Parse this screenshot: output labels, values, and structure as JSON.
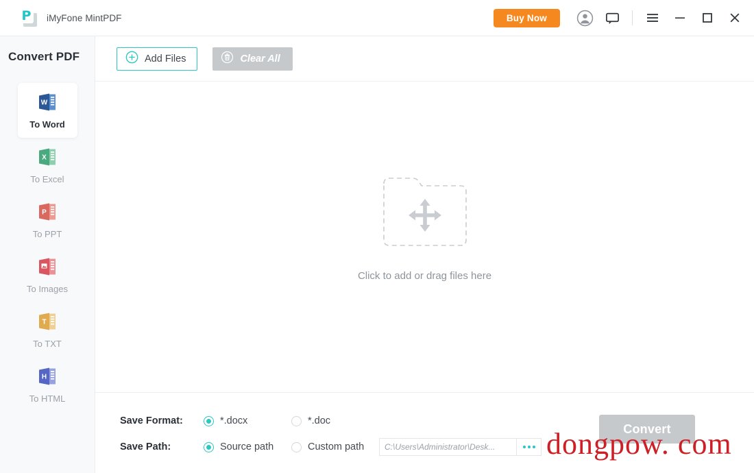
{
  "titlebar": {
    "app_title": "iMyFone MintPDF",
    "logo_letter": "P",
    "buy_now_label": "Buy Now",
    "icons": {
      "account": "account-circle-icon",
      "feedback": "feedback-bubble-icon",
      "menu": "hamburger-menu-icon",
      "minimize": "minimize-icon",
      "maximize": "maximize-icon",
      "close": "close-icon"
    }
  },
  "sidebar": {
    "title": "Convert PDF",
    "items": [
      {
        "label": "To Word",
        "icon": "word-file-icon",
        "glyph": "W",
        "color": "#2b5797",
        "accent": "#4f81c7",
        "active": true
      },
      {
        "label": "To Excel",
        "icon": "excel-file-icon",
        "glyph": "X",
        "color": "#4aa97f",
        "accent": "#8ecfae",
        "active": false
      },
      {
        "label": "To PPT",
        "icon": "ppt-file-icon",
        "glyph": "P",
        "color": "#d9685f",
        "accent": "#ec9a92",
        "active": false
      },
      {
        "label": "To Images",
        "icon": "image-file-icon",
        "glyph": "▣",
        "color": "#d9555f",
        "accent": "#eb9198",
        "active": false
      },
      {
        "label": "To TXT",
        "icon": "txt-file-icon",
        "glyph": "T",
        "color": "#e0ab4e",
        "accent": "#f0cf93",
        "active": false
      },
      {
        "label": "To HTML",
        "icon": "html-file-icon",
        "glyph": "H",
        "color": "#5566c4",
        "accent": "#97a2e0",
        "active": false
      }
    ]
  },
  "toolbar": {
    "add_files_label": "Add Files",
    "add_files_icon": "plus-circle-icon",
    "clear_all_label": "Clear All",
    "clear_all_icon": "trash-circle-icon",
    "clear_all_disabled": true
  },
  "dropzone": {
    "icon": "move-arrows-icon",
    "folder_icon": "dashed-folder-icon",
    "text": "Click to add or drag files here"
  },
  "footer": {
    "save_format_label": "Save Format:",
    "format_options": [
      {
        "label": "*.docx",
        "selected": true
      },
      {
        "label": "*.doc",
        "selected": false
      }
    ],
    "save_path_label": "Save Path:",
    "path_options": [
      {
        "label": "Source path",
        "selected": true
      },
      {
        "label": "Custom path",
        "selected": false
      }
    ],
    "path_value": "C:\\Users\\Administrator\\Desk...",
    "path_browse_label": "•••",
    "convert_label": "Convert",
    "convert_disabled": true
  },
  "watermark": {
    "text": "dongpow. com",
    "color": "#cc2026"
  },
  "colors": {
    "accent_teal": "#2ec5c5",
    "buy_orange": "#f5891f",
    "disabled_gray": "#c6c9cc",
    "sidebar_bg": "#f8f9fa",
    "text_dark": "#2b3036",
    "text_muted": "#9aa1a8"
  }
}
